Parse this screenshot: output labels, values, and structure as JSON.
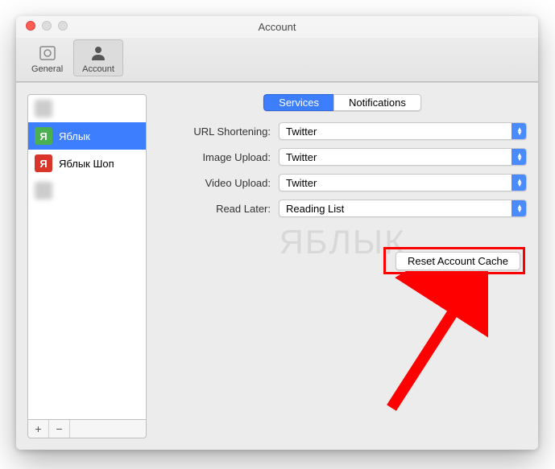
{
  "window": {
    "title": "Account"
  },
  "toolbar": {
    "tabs": [
      {
        "label": "General"
      },
      {
        "label": "Account"
      }
    ]
  },
  "sidebar": {
    "accounts": [
      {
        "name": "",
        "blurred": true
      },
      {
        "name": "Яблык",
        "selected": true,
        "avatar_letter": "Я",
        "avatar_color": "green"
      },
      {
        "name": "Яблык Шоп",
        "avatar_letter": "Я",
        "avatar_color": "red"
      },
      {
        "name": "",
        "blurred": true
      }
    ],
    "add": "+",
    "remove": "−"
  },
  "segmented": {
    "services": "Services",
    "notifications": "Notifications"
  },
  "form": {
    "url_shortening": {
      "label": "URL Shortening:",
      "value": "Twitter"
    },
    "image_upload": {
      "label": "Image Upload:",
      "value": "Twitter"
    },
    "video_upload": {
      "label": "Video Upload:",
      "value": "Twitter"
    },
    "read_later": {
      "label": "Read Later:",
      "value": "Reading List"
    }
  },
  "reset_button": "Reset Account Cache",
  "watermark": "ЯБЛЫК"
}
